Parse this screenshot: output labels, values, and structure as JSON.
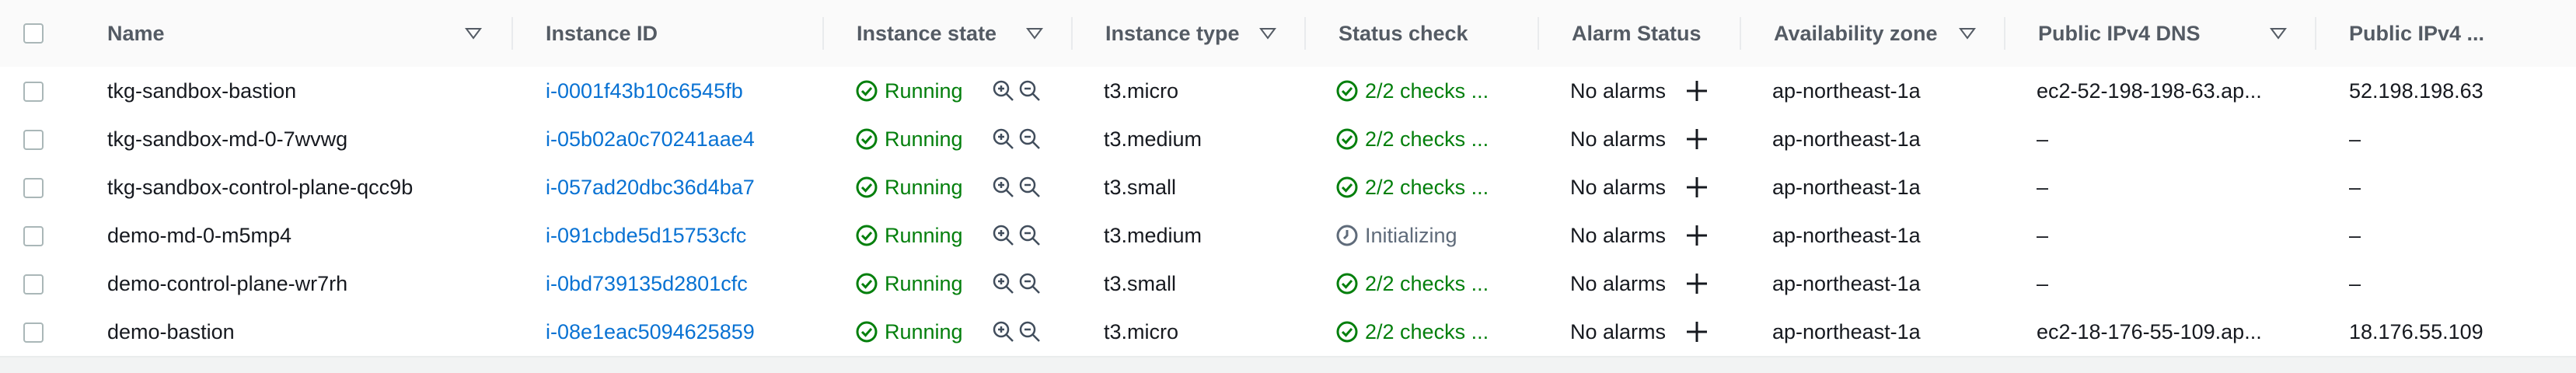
{
  "header": {
    "columns": [
      "Name",
      "Instance ID",
      "Instance state",
      "Instance type",
      "Status check",
      "Alarm Status",
      "Availability zone",
      "Public IPv4 DNS",
      "Public IPv4 ..."
    ]
  },
  "rows": [
    {
      "name": "tkg-sandbox-bastion",
      "id": "i-0001f43b10c6545fb",
      "state": "Running",
      "type": "t3.micro",
      "status": "2/2 checks ...",
      "status_kind": "ok",
      "alarm": "No alarms",
      "az": "ap-northeast-1a",
      "dns": "ec2-52-198-198-63.ap...",
      "ip": "52.198.198.63"
    },
    {
      "name": "tkg-sandbox-md-0-7wvwg",
      "id": "i-05b02a0c70241aae4",
      "state": "Running",
      "type": "t3.medium",
      "status": "2/2 checks ...",
      "status_kind": "ok",
      "alarm": "No alarms",
      "az": "ap-northeast-1a",
      "dns": "–",
      "ip": "–"
    },
    {
      "name": "tkg-sandbox-control-plane-qcc9b",
      "id": "i-057ad20dbc36d4ba7",
      "state": "Running",
      "type": "t3.small",
      "status": "2/2 checks ...",
      "status_kind": "ok",
      "alarm": "No alarms",
      "az": "ap-northeast-1a",
      "dns": "–",
      "ip": "–"
    },
    {
      "name": "demo-md-0-m5mp4",
      "id": "i-091cbde5d15753cfc",
      "state": "Running",
      "type": "t3.medium",
      "status": "Initializing",
      "status_kind": "pending",
      "alarm": "No alarms",
      "az": "ap-northeast-1a",
      "dns": "–",
      "ip": "–"
    },
    {
      "name": "demo-control-plane-wr7rh",
      "id": "i-0bd739135d2801cfc",
      "state": "Running",
      "type": "t3.small",
      "status": "2/2 checks ...",
      "status_kind": "ok",
      "alarm": "No alarms",
      "az": "ap-northeast-1a",
      "dns": "–",
      "ip": "–"
    },
    {
      "name": "demo-bastion",
      "id": "i-08e1eac5094625859",
      "state": "Running",
      "type": "t3.micro",
      "status": "2/2 checks ...",
      "status_kind": "ok",
      "alarm": "No alarms",
      "az": "ap-northeast-1a",
      "dns": "ec2-18-176-55-109.ap...",
      "ip": "18.176.55.109"
    }
  ],
  "colors": {
    "link": "#0972d3",
    "success": "#037f0c",
    "muted": "#5f6b7a",
    "header_text": "#545b64"
  }
}
